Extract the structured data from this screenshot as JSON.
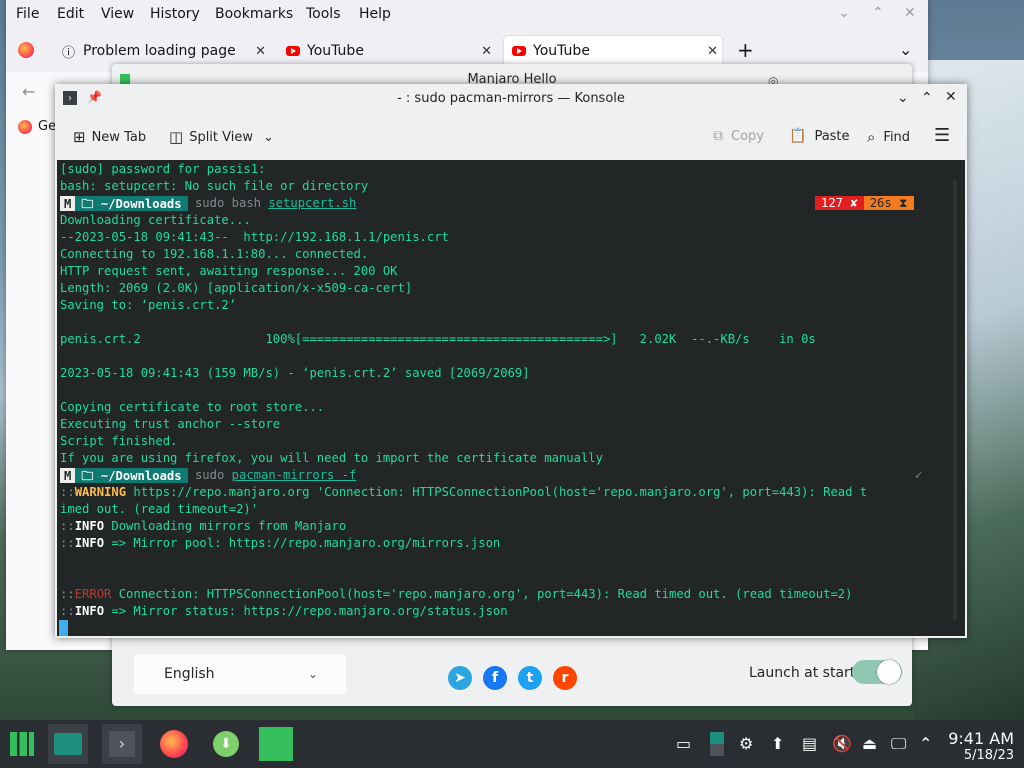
{
  "firefox": {
    "menu": [
      "File",
      "Edit",
      "View",
      "History",
      "Bookmarks",
      "Tools",
      "Help"
    ],
    "tabs": [
      {
        "label": "Problem loading page"
      },
      {
        "label": "YouTube"
      },
      {
        "label": "YouTube"
      }
    ],
    "new_tab_glyph": "+",
    "bookmark_label": "Ge"
  },
  "hello": {
    "title": "Manjaro Hello",
    "language": "English",
    "launch_label": "Launch at start",
    "social": [
      {
        "name": "telegram",
        "glyph": "➤",
        "color": "#2ca5e0"
      },
      {
        "name": "facebook",
        "glyph": "f",
        "color": "#1877f2"
      },
      {
        "name": "twitter",
        "glyph": "t",
        "color": "#1da1f2"
      },
      {
        "name": "reddit",
        "glyph": "r",
        "color": "#ff4500"
      }
    ]
  },
  "konsole": {
    "title": "- : sudo pacman-mirrors — Konsole",
    "toolbar": {
      "new_tab": "New Tab",
      "split_view": "Split View",
      "copy": "Copy",
      "paste": "Paste",
      "find": "Find"
    },
    "terminal": {
      "l1": "[sudo] password for passis1:",
      "l2": "bash: setupcert: No such file or directory",
      "p1_dir": "~/Downloads",
      "p1_cmd_sudo": "sudo",
      "p1_cmd_bash": "bash",
      "p1_cmd_file": "setupcert.sh",
      "p1_status_code": "127 ✘",
      "p1_status_time": "26s ⧗",
      "l3": "Downloading certificate...",
      "l4": "--2023-05-18 09:41:43--  http://192.168.1.1/penis.crt",
      "l5": "Connecting to 192.168.1.1:80... connected.",
      "l6": "HTTP request sent, awaiting response... 200 OK",
      "l7": "Length: 2069 (2.0K) [application/x-x509-ca-cert]",
      "l8": "Saving to: ‘penis.crt.2’",
      "l9": "penis.crt.2                 100%[=========================================>]   2.02K  --.-KB/s    in 0s",
      "l10": "2023-05-18 09:41:43 (159 MB/s) - ‘penis.crt.2’ saved [2069/2069]",
      "l11": "Copying certificate to root store...",
      "l12": "Executing trust anchor --store",
      "l13": "Script finished.",
      "l14": "If you are using firefox, you will need to import the certificate manually",
      "p2_dir": "~/Downloads",
      "p2_cmd_sudo": "sudo",
      "p2_cmd_rest": "pacman-mirrors -f",
      "p2_check": "✓",
      "w_prefix": "::",
      "w_tag": "WARNING",
      "w_text": " https://repo.manjaro.org 'Connection: HTTPSConnectionPool(host='repo.manjaro.org', port=443): Read t",
      "w_text2": "imed out. (read timeout=2)'",
      "i1_tag": "INFO",
      "i1_text": " Downloading mirrors from Manjaro",
      "i2_tag": "INFO",
      "i2_text": " => Mirror pool: https://repo.manjaro.org/mirrors.json",
      "e_tag": "ERROR",
      "e_text": " Connection: HTTPSConnectionPool(host='repo.manjaro.org', port=443): Read timed out. (read timeout=2)",
      "i3_tag": "INFO",
      "i3_text": " => Mirror status: https://repo.manjaro.org/status.json"
    }
  },
  "taskbar": {
    "time": "9:41 AM",
    "date": "5/18/23"
  }
}
